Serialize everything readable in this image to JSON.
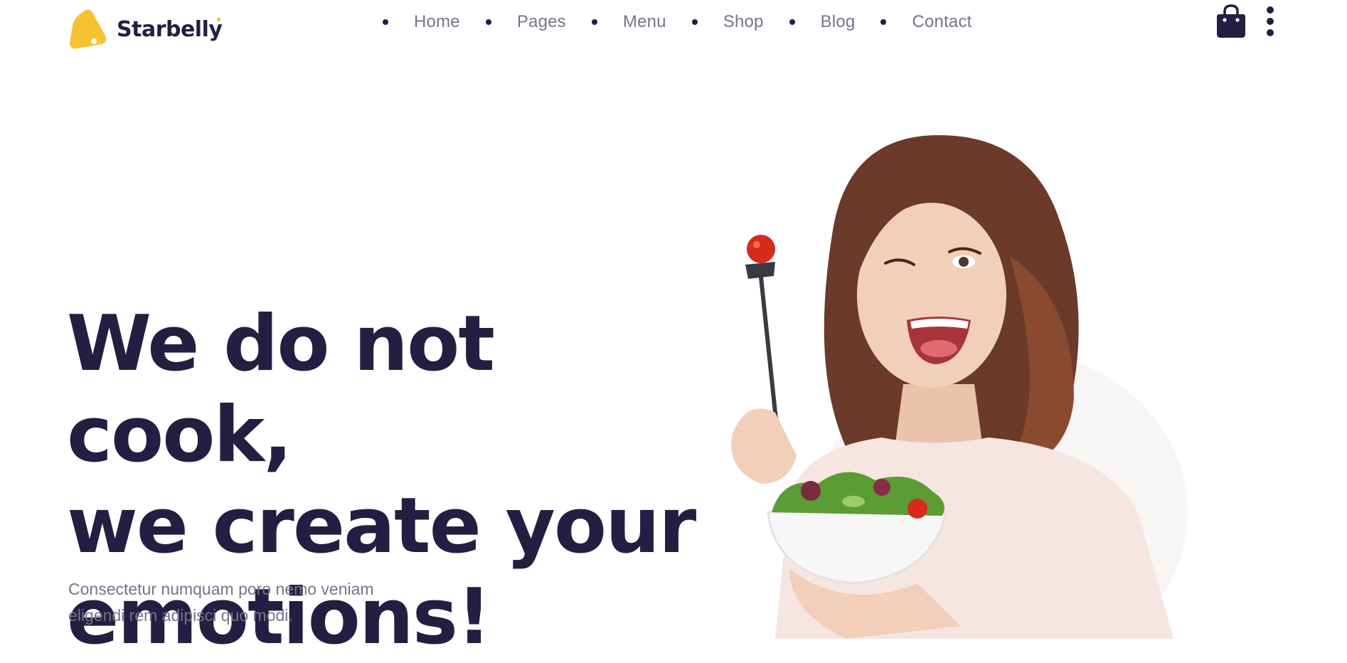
{
  "brand": {
    "name": "Starbelly",
    "accent_color": "#f5c332",
    "text_color": "#221f42"
  },
  "nav": {
    "items": [
      {
        "label": "Home"
      },
      {
        "label": "Pages"
      },
      {
        "label": "Menu"
      },
      {
        "label": "Shop"
      },
      {
        "label": "Blog"
      },
      {
        "label": "Contact"
      }
    ]
  },
  "header_icons": {
    "cart": "shopping-bag-icon",
    "more": "more-vertical-icon"
  },
  "hero": {
    "title_lines": [
      "We do not cook,",
      "we create your",
      "emotions!"
    ],
    "subtitle_line1": "Consectetur numquam poro nemo veniam",
    "subtitle_line2": "eligendi rem adipisci quo modi.",
    "image": "woman-eating-salad-photo"
  }
}
